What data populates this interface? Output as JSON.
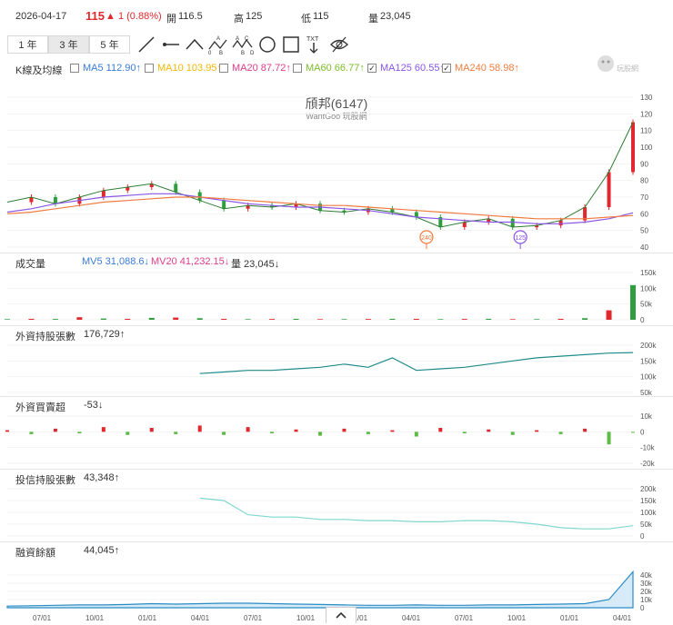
{
  "quote": {
    "date": "2026-04-17",
    "price": "115",
    "change": "▲ 1 (0.88%)",
    "open_label": "開",
    "open": "116.5",
    "high_label": "高",
    "high": "125",
    "low_label": "低",
    "low": "115",
    "vol_label": "量",
    "volume": "23,045"
  },
  "ranges": [
    "1 年",
    "3 年",
    "5 年"
  ],
  "active_range": "3 年",
  "drawing_tools": [
    "line-tool-icon",
    "horizontal-line-icon",
    "angle-icon",
    "abcd-pattern-icon",
    "abcde-pattern-icon",
    "circle-icon",
    "rectangle-icon",
    "text-tool-icon",
    "hide-eye-icon"
  ],
  "tool_labels": {
    "text": "TXT",
    "a": "A",
    "b": "B",
    "c": "C",
    "d": "D",
    "zero": "0"
  },
  "ma_panel": {
    "label": "K線及均線",
    "items": [
      {
        "text": "MA5 112.90↑",
        "checked": false,
        "color": "#3a7bd5"
      },
      {
        "text": "MA10 103.95↑",
        "checked": false,
        "color": "#f2b705"
      },
      {
        "text": "MA20 87.72↑",
        "checked": false,
        "color": "#e03c8a"
      },
      {
        "text": "MA60 66.77↑",
        "checked": false,
        "color": "#7cbd2a"
      },
      {
        "text": "MA125 60.55↑",
        "checked": true,
        "color": "#8a55e6"
      },
      {
        "text": "MA240 58.98↑",
        "checked": true,
        "color": "#f07b3f"
      }
    ]
  },
  "watermark": {
    "title": "頎邦(6147)",
    "sub": "WantGoo 玩股網",
    "logo": "玩股網"
  },
  "markers": [
    "240",
    "125"
  ],
  "volume_panel": {
    "label": "成交量",
    "mv5": "MV5 31,088.6↓",
    "mv20": "MV20 41,232.15↓",
    "vol": "量 23,045↓",
    "mv5_color": "#3a7bd5",
    "mv20_color": "#e03c8a"
  },
  "foreign_hold": {
    "label": "外資持股張數",
    "value": "176,729↑"
  },
  "foreign_net": {
    "label": "外資買賣超",
    "value": "-53↓"
  },
  "trust_hold": {
    "label": "投信持股張數",
    "value": "43,348↑"
  },
  "margin": {
    "label": "融資餘額",
    "value": "44,045↑"
  },
  "x_dates": [
    "07/01",
    "10/01",
    "01/01",
    "04/01",
    "07/01",
    "10/01",
    "01/01",
    "04/01",
    "07/01",
    "10/01",
    "01/01",
    "04/01"
  ],
  "chart_data": [
    {
      "type": "line",
      "title": "頎邦(6147)",
      "y_ticks": [
        "130",
        "120",
        "110",
        "100",
        "90",
        "80",
        "70",
        "60",
        "50",
        "40"
      ],
      "ylim": [
        40,
        130
      ],
      "series": [
        {
          "name": "K線",
          "values": [
            67,
            70,
            66,
            70,
            74,
            76,
            78,
            73,
            68,
            63,
            65,
            64,
            66,
            62,
            61,
            63,
            61,
            58,
            52,
            55,
            57,
            52,
            53,
            56,
            64,
            85,
            115
          ]
        },
        {
          "name": "MA125",
          "values": [
            61,
            63,
            66,
            68,
            70,
            71,
            72,
            72,
            70,
            68,
            66,
            65,
            64,
            64,
            63,
            62,
            60,
            58,
            57,
            56,
            55,
            55,
            54,
            54,
            55,
            57,
            60.55
          ]
        },
        {
          "name": "MA240",
          "values": [
            60,
            61,
            63,
            65,
            67,
            68,
            69,
            70,
            70,
            69,
            68,
            67,
            66,
            65,
            65,
            64,
            63,
            62,
            61,
            60,
            59,
            58,
            57,
            57,
            57,
            58,
            58.98
          ]
        }
      ]
    },
    {
      "type": "bar",
      "title": "成交量",
      "y_ticks": [
        "150k",
        "100k",
        "50k",
        "0"
      ],
      "ylim": [
        0,
        150000
      ],
      "values": [
        2000,
        3000,
        2500,
        8000,
        4000,
        3000,
        6000,
        7000,
        5000,
        3000,
        2000,
        2500,
        3000,
        2000,
        2000,
        2500,
        3000,
        3000,
        2000,
        2500,
        3000,
        2000,
        2000,
        3000,
        5000,
        30000,
        110000
      ]
    },
    {
      "type": "line",
      "title": "外資持股張數",
      "y_ticks": [
        "200k",
        "150k",
        "100k",
        "50k"
      ],
      "ylim": [
        50000,
        200000
      ],
      "values": [
        null,
        null,
        null,
        null,
        null,
        null,
        null,
        null,
        110000,
        115000,
        120000,
        120000,
        125000,
        130000,
        140000,
        130000,
        160000,
        120000,
        125000,
        130000,
        140000,
        150000,
        160000,
        165000,
        170000,
        175000,
        176729
      ]
    },
    {
      "type": "bar",
      "title": "外資買賣超",
      "y_ticks": [
        "10k",
        "0",
        "-10k",
        "-20k"
      ],
      "ylim": [
        -20000,
        10000
      ],
      "values": [
        1000,
        -1500,
        2000,
        -1000,
        3000,
        -2000,
        2500,
        -1500,
        4000,
        -2000,
        3000,
        -1000,
        1500,
        -2500,
        2000,
        -1500,
        1000,
        -3000,
        2500,
        -1000,
        1500,
        -2000,
        1000,
        -1500,
        2000,
        -8000,
        -53
      ]
    },
    {
      "type": "line",
      "title": "投信持股張數",
      "y_ticks": [
        "200k",
        "150k",
        "100k",
        "50k",
        "0"
      ],
      "ylim": [
        0,
        200000
      ],
      "values": [
        null,
        null,
        null,
        null,
        null,
        null,
        null,
        null,
        160000,
        150000,
        90000,
        80000,
        80000,
        70000,
        70000,
        65000,
        65000,
        60000,
        60000,
        65000,
        65000,
        60000,
        50000,
        35000,
        30000,
        30000,
        43348
      ]
    },
    {
      "type": "area",
      "title": "融資餘額",
      "y_ticks": [
        "40k",
        "30k",
        "20k",
        "10k",
        "0"
      ],
      "ylim": [
        0,
        40000
      ],
      "values": [
        2000,
        2500,
        3000,
        3500,
        3500,
        4000,
        5000,
        4500,
        5000,
        5500,
        5500,
        5000,
        4500,
        4000,
        3500,
        3000,
        3000,
        3500,
        3000,
        3000,
        3500,
        3500,
        4000,
        4500,
        5000,
        10000,
        44045
      ]
    }
  ]
}
